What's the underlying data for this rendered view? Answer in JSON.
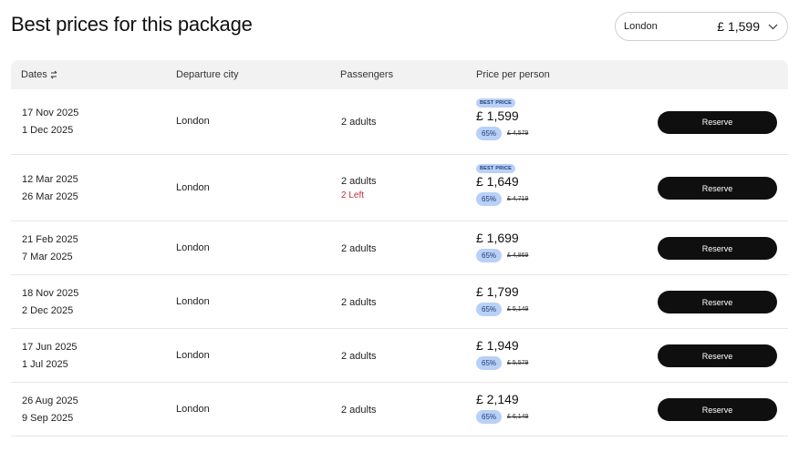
{
  "page": {
    "title": "Best prices for this package"
  },
  "city_select": {
    "city": "London",
    "price": "£ 1,599",
    "icon": "chevron-down-icon"
  },
  "table": {
    "headers": {
      "dates": "Dates",
      "departure_city": "Departure city",
      "passengers": "Passengers",
      "price_per_person": "Price per person"
    },
    "sort_icon": "sort-arrows-icon",
    "rows": [
      {
        "date_start": "17 Nov 2025",
        "date_end": "1 Dec 2025",
        "city": "London",
        "passengers": "2 adults",
        "note": "",
        "badge": "BEST PRICE",
        "price": "£ 1,599",
        "discount": "65%",
        "original_price": "£ 4,579",
        "action": "Reserve"
      },
      {
        "date_start": "12 Mar 2025",
        "date_end": "26 Mar 2025",
        "city": "London",
        "passengers": "2 adults",
        "note": "2 Left",
        "badge": "BEST PRICE",
        "price": "£ 1,649",
        "discount": "65%",
        "original_price": "£ 4,719",
        "action": "Reserve"
      },
      {
        "date_start": "21 Feb 2025",
        "date_end": "7 Mar 2025",
        "city": "London",
        "passengers": "2 adults",
        "note": "",
        "badge": "",
        "price": "£ 1,699",
        "discount": "65%",
        "original_price": "£ 4,869",
        "action": "Reserve"
      },
      {
        "date_start": "18 Nov 2025",
        "date_end": "2 Dec 2025",
        "city": "London",
        "passengers": "2 adults",
        "note": "",
        "badge": "",
        "price": "£ 1,799",
        "discount": "65%",
        "original_price": "£ 5,149",
        "action": "Reserve"
      },
      {
        "date_start": "17 Jun 2025",
        "date_end": "1 Jul 2025",
        "city": "London",
        "passengers": "2 adults",
        "note": "",
        "badge": "",
        "price": "£ 1,949",
        "discount": "65%",
        "original_price": "£ 5,579",
        "action": "Reserve"
      },
      {
        "date_start": "26 Aug 2025",
        "date_end": "9 Sep 2025",
        "city": "London",
        "passengers": "2 adults",
        "note": "",
        "badge": "",
        "price": "£ 2,149",
        "discount": "65%",
        "original_price": "£ 6,149",
        "action": "Reserve"
      }
    ]
  },
  "colors": {
    "accent_badge": "#b9d0f7",
    "button": "#0f0f0f",
    "note": "#c0303a"
  }
}
